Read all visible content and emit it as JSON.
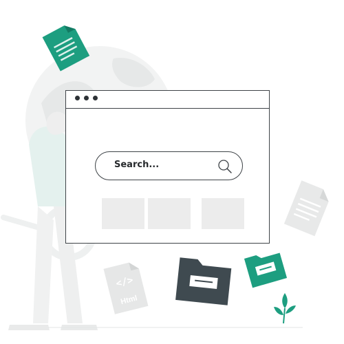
{
  "search": {
    "placeholder": "Search..."
  },
  "files": {
    "html_label": "Html",
    "code_symbol": "</>"
  },
  "colors": {
    "accent": "#1d9e80",
    "dark": "#3d4246",
    "tile": "#ececec",
    "ghost": "#f0f1f1"
  },
  "icons": [
    "search-icon",
    "document-icon",
    "folder-icon",
    "html-file-icon",
    "plant-icon",
    "globe-icon"
  ]
}
